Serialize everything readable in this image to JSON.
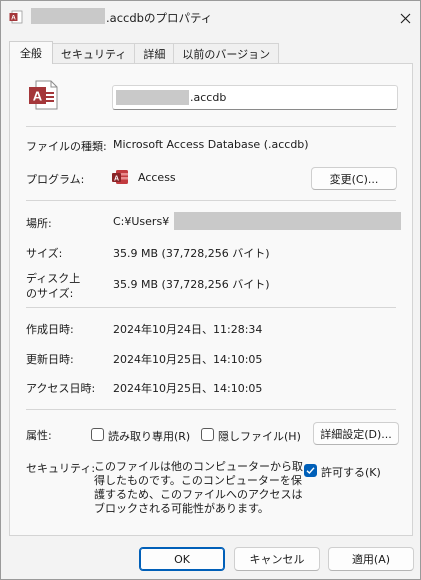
{
  "window": {
    "title_suffix": ".accdbのプロパティ",
    "close_label": "✕"
  },
  "tabs": [
    {
      "label": "全般",
      "active": true
    },
    {
      "label": "セキュリティ",
      "active": false
    },
    {
      "label": "詳細",
      "active": false
    },
    {
      "label": "以前のバージョン",
      "active": false
    }
  ],
  "general": {
    "file_name_suffix": ".accdb",
    "file_type_label": "ファイルの種類:",
    "file_type_value": "Microsoft Access Database (.accdb)",
    "program_label": "プログラム:",
    "program_value": "Access",
    "change_button": "変更(C)...",
    "location_label": "場所:",
    "location_value": "C:¥Users¥",
    "size_label": "サイズ:",
    "size_value": "35.9 MB (37,728,256 バイト)",
    "disk_size_label_line1": "ディスク上",
    "disk_size_label_line2": "のサイズ:",
    "disk_size_value": "35.9 MB (37,728,256 バイト)",
    "created_label": "作成日時:",
    "created_value": "2024年10月24日、11:28:34",
    "modified_label": "更新日時:",
    "modified_value": "2024年10月25日、14:10:05",
    "accessed_label": "アクセス日時:",
    "accessed_value": "2024年10月25日、14:10:05",
    "attributes_label": "属性:",
    "readonly_label": "読み取り専用(R)",
    "readonly_checked": false,
    "hidden_label": "隠しファイル(H)",
    "hidden_checked": false,
    "advanced_button": "詳細設定(D)...",
    "security_label": "セキュリティ:",
    "security_text": "このファイルは他のコンピューターから取得したものです。このコンピューターを保護するため、このファイルへのアクセスはブロックされる可能性があります。",
    "unblock_label": "許可する(K)",
    "unblock_checked": true
  },
  "footer": {
    "ok": "OK",
    "cancel": "キャンセル",
    "apply": "適用(A)"
  },
  "colors": {
    "access_red": "#a4373a",
    "accent": "#005fb8",
    "redaction": "#c9c9c9"
  }
}
